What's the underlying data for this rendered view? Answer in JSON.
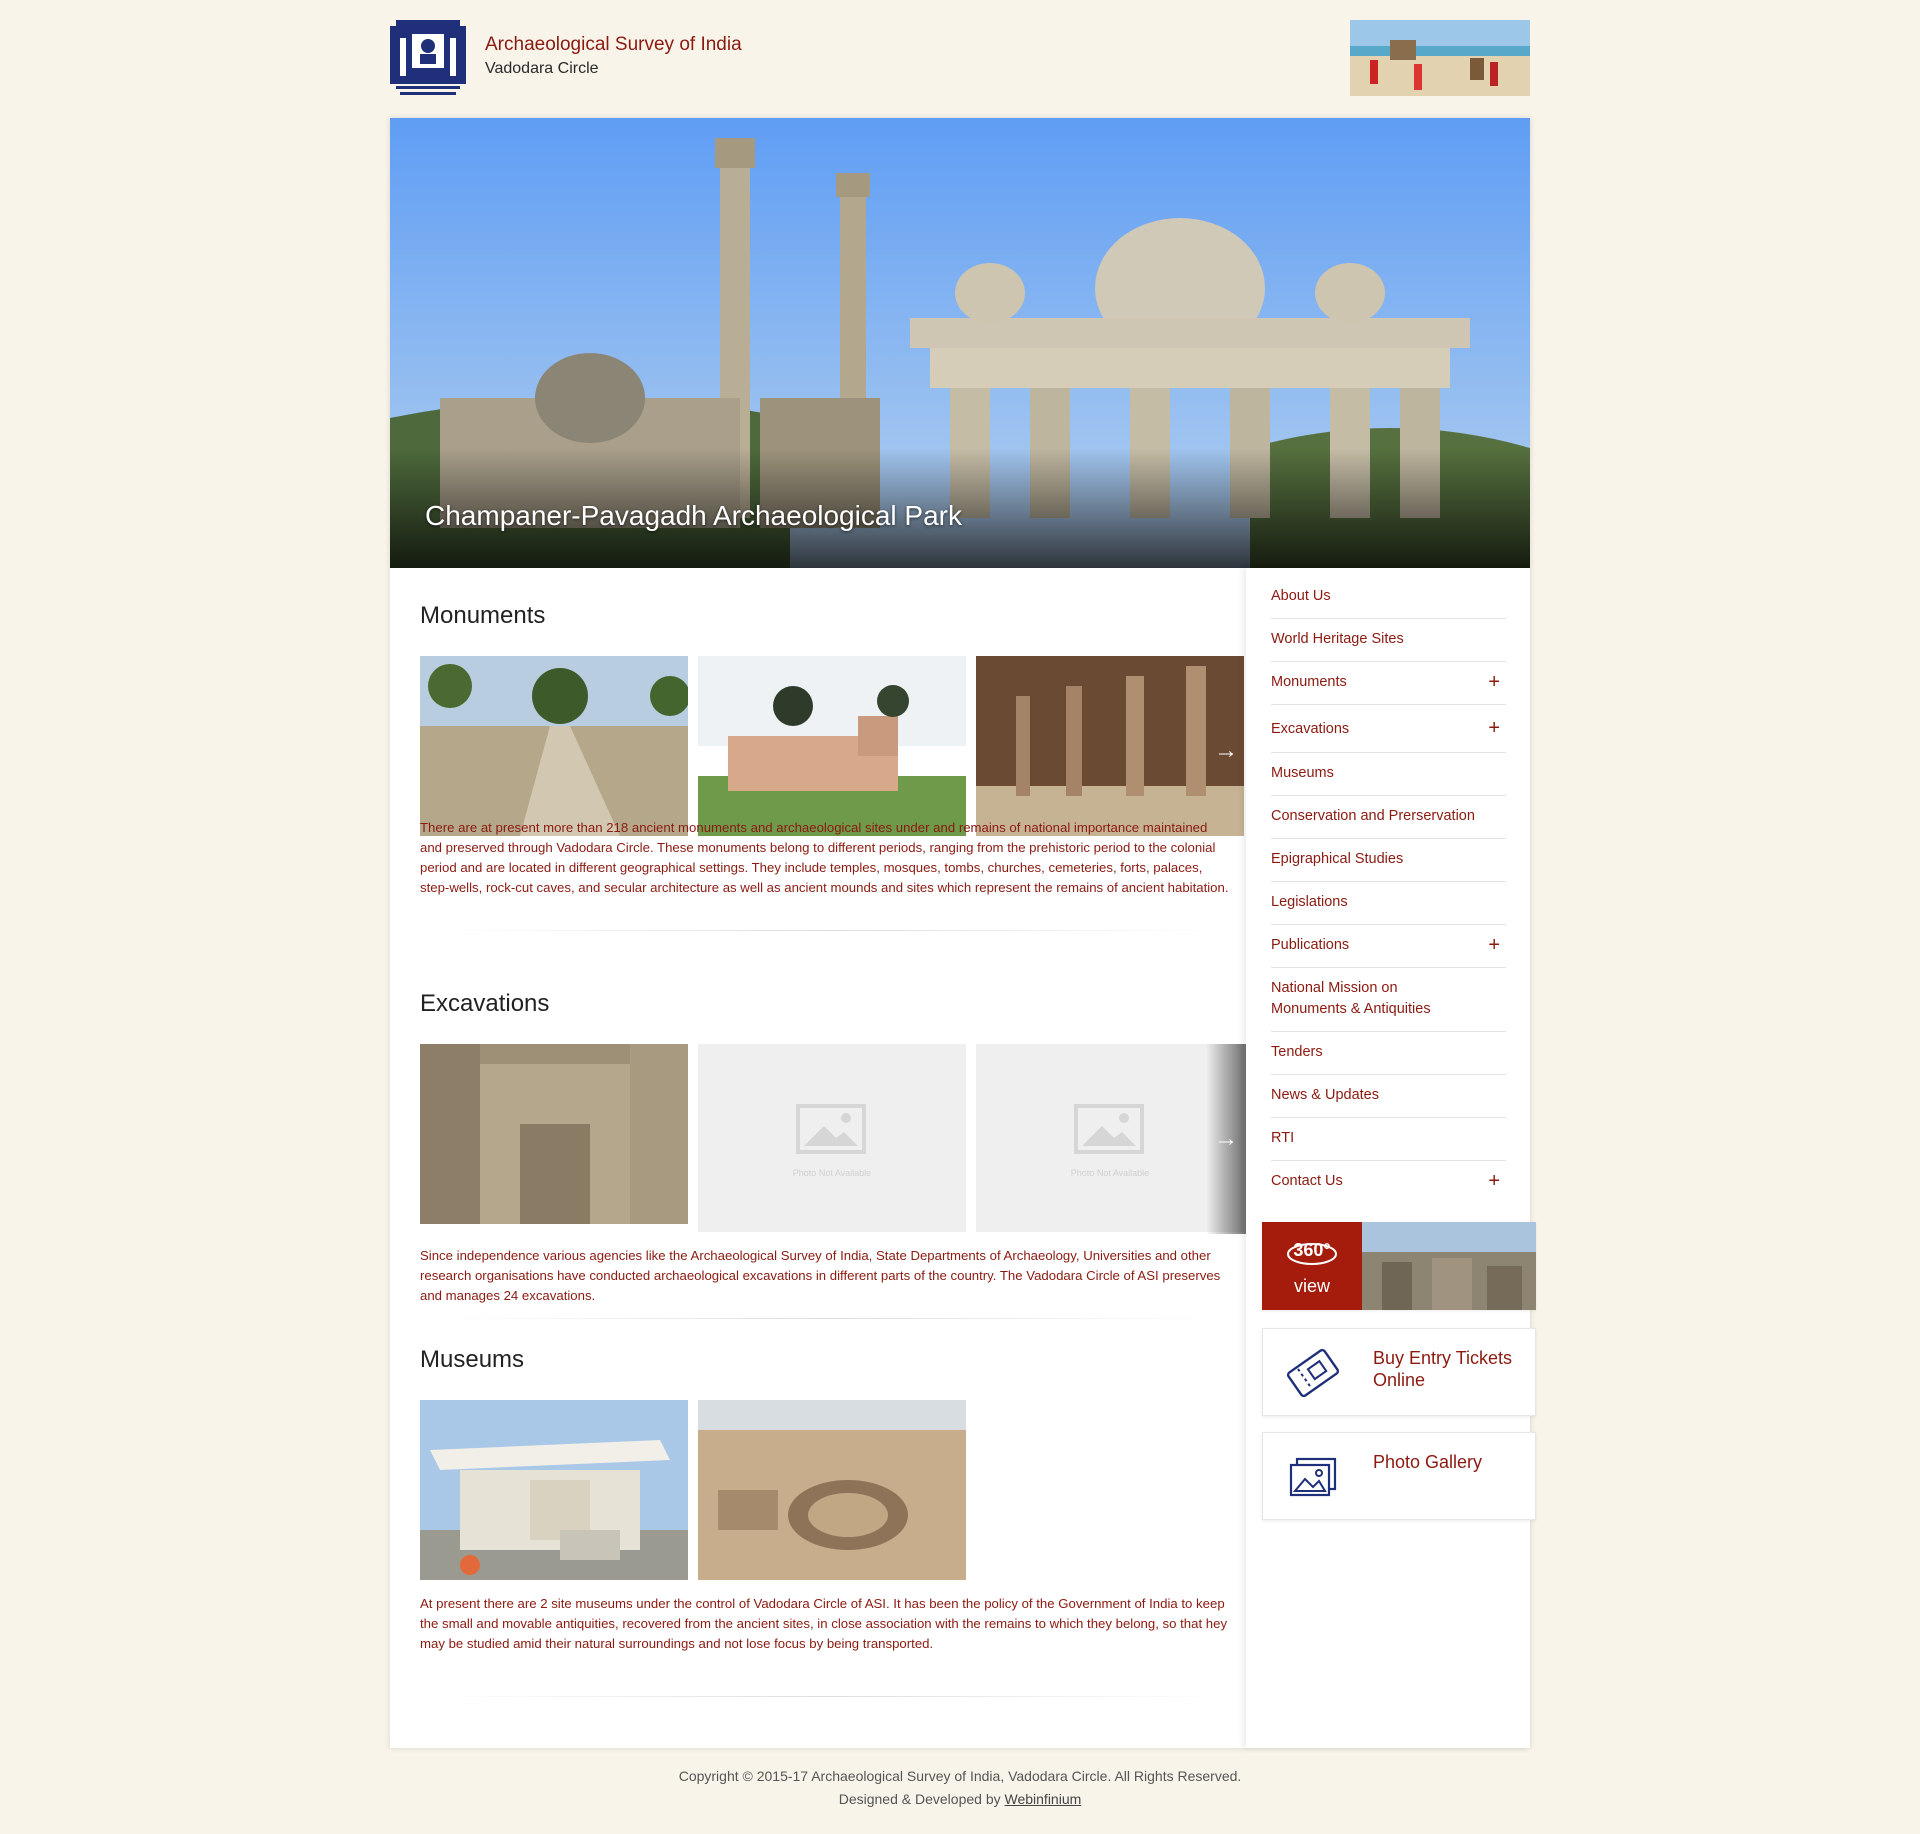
{
  "header": {
    "title": "Archaeological Survey of India",
    "subtitle": "Vadodara Circle"
  },
  "hero": {
    "caption": "Champaner-Pavagadh Archaeological Park"
  },
  "sections": {
    "monuments": {
      "title": "Monuments",
      "text": "There are at present more than 218 ancient monuments and archaeological sites under and remains of national importance maintained and preserved through Vadodara Circle. These monuments belong to different periods, ranging from the prehistoric period to the colonial period and are located in different geographical settings. They include temples, mosques, tombs, churches, cemeteries, forts, palaces, step-wells, rock-cut caves, and secular architecture as well as ancient mounds and sites which represent the remains of ancient habitation."
    },
    "excavations": {
      "title": "Excavations",
      "na_label": "Photo Not Available",
      "text": "Since independence various agencies like the Archaeological Survey of India, State Departments of Archaeology, Universities and other research organisations have conducted archaeological excavations in different parts of the country. The Vadodara Circle of ASI preserves and manages 24 excavations."
    },
    "museums": {
      "title": "Museums",
      "text": "At present there are 2 site museums under the control of Vadodara Circle of ASI. It has been the policy of the Government of India to keep the small and movable antiquities, recovered from the ancient sites, in close association with the remains to which they belong, so that hey may be studied amid their natural surroundings and not lose focus by being transported."
    }
  },
  "arrow_glyph": "→",
  "menu": {
    "plus_glyph": "+",
    "items": [
      {
        "label": "About Us"
      },
      {
        "label": "World Heritage Sites"
      },
      {
        "label": "Monuments"
      },
      {
        "label": "Excavations"
      },
      {
        "label": "Museums"
      },
      {
        "label": "Conservation and Prerservation"
      },
      {
        "label": "Epigraphical Studies"
      },
      {
        "label": "Legislations"
      },
      {
        "label": "Publications"
      },
      {
        "label": "National Mission on Monuments & Antiquities"
      },
      {
        "label": "Tenders"
      },
      {
        "label": "News & Updates"
      },
      {
        "label": "RTI"
      },
      {
        "label": "Contact Us"
      }
    ]
  },
  "widgets": {
    "view360": {
      "badge": "360°",
      "label": "view"
    },
    "tickets": {
      "label": "Buy Entry Tickets Online"
    },
    "gallery": {
      "label": "Photo Gallery"
    }
  },
  "footer": {
    "copyright": "Copyright © 2015-17 Archaeological Survey of India, Vadodara Circle. All Rights Reserved.",
    "designed_prefix": "Designed & Developed by",
    "designer_link": "Webinfinium"
  },
  "colors": {
    "accent": "#8b1a10",
    "badge": "#a51c0c",
    "page_bg": "#f8f4ea"
  }
}
